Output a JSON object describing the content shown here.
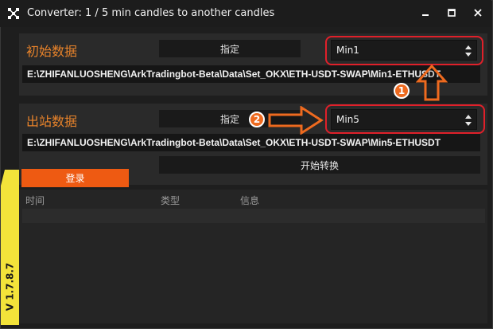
{
  "window": {
    "title": "Converter: 1 / 5 min candles to another candles"
  },
  "input_section": {
    "label": "初始数据",
    "assign_label": "指定",
    "timeframe": "Min1",
    "path": "E:\\ZHIFANLUOSHENG\\ArkTradingbot-Beta\\Data\\Set_OKX\\ETH-USDT-SWAP\\Min1-ETHUSDT"
  },
  "output_section": {
    "label": "出站数据",
    "assign_label": "指定",
    "timeframe": "Min5",
    "path": "E:\\ZHIFANLUOSHENG\\ArkTradingbot-Beta\\Data\\Set_OKX\\ETH-USDT-SWAP\\Min5-ETHUSDT"
  },
  "actions": {
    "convert_label": "开始转换",
    "login_label": "登录"
  },
  "log": {
    "columns": [
      "时间",
      "类型",
      "信息"
    ]
  },
  "version": "V 1.7.8.7",
  "annotations": {
    "step1": "1",
    "step2": "2"
  },
  "colors": {
    "accent": "#ee5a12",
    "label_orange": "#e8832a",
    "highlight_red": "#e0202a",
    "version_yellow": "#f3e33a"
  }
}
